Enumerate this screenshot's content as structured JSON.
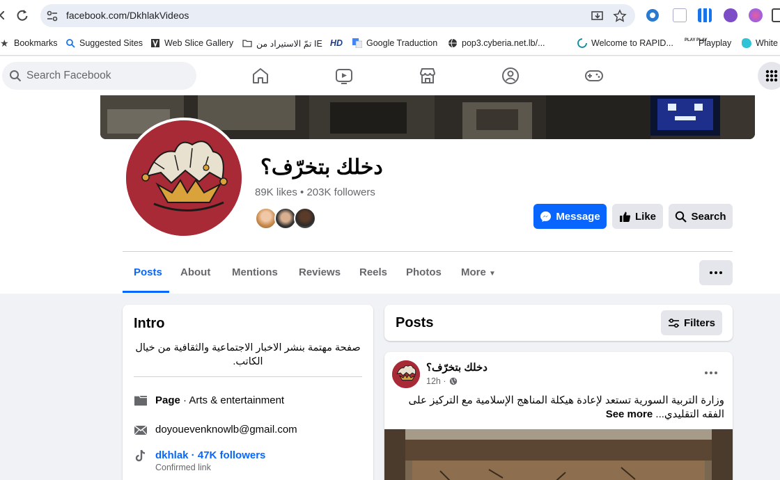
{
  "browser": {
    "url": "facebook.com/DkhlakVideos",
    "bookmarks": [
      {
        "label": "Bookmarks",
        "icon": "star-icon"
      },
      {
        "label": "Suggested Sites",
        "icon": "search-icon"
      },
      {
        "label": "Web Slice Gallery",
        "icon": "web-slice-icon"
      },
      {
        "label": "تمّ الاستيراد من IE",
        "icon": "folder-icon"
      },
      {
        "label": "HD",
        "icon": "hd-icon"
      },
      {
        "label": "Google Traduction",
        "icon": "translate-icon"
      },
      {
        "label": "pop3.cyberia.net.lb/...",
        "icon": "globe-icon"
      },
      {
        "label": "Welcome to RAPID...",
        "icon": "rapid-icon"
      },
      {
        "label": "Playplay",
        "icon": "playplay-icon"
      },
      {
        "label": "White",
        "icon": "white-icon"
      }
    ]
  },
  "facebook": {
    "search_placeholder": "Search Facebook",
    "page": {
      "name": "دخلك بتخرّف؟",
      "stats": "89K likes • 203K followers",
      "buttons": {
        "message": "Message",
        "like": "Like",
        "search": "Search"
      },
      "tabs": [
        "Posts",
        "About",
        "Mentions",
        "Reviews",
        "Reels",
        "Photos",
        "More"
      ]
    },
    "intro": {
      "title": "Intro",
      "bio": "صفحة مهتمة بنشر الاخبار الاجتماعية والثقافية من خيال الكاتب.",
      "category_bold": "Page",
      "category": " · Arts & entertainment",
      "email": "doyouevenknowlb@gmail.com",
      "tiktok": "dkhlak · 47K followers",
      "tiktok_sub": "Confirmed link"
    },
    "posts": {
      "title": "Posts",
      "filters_label": "Filters",
      "first": {
        "author": "دخلك بتخرّف؟",
        "time": "12h ·",
        "text": "وزارة التربية السورية تستعد لإعادة هيكلة المناهج الإسلامية مع التركيز على الفقه التقليدي...",
        "see_more": "See more"
      }
    }
  },
  "colors": {
    "fb_blue": "#0866ff",
    "avatar_red": "#a82a36"
  }
}
